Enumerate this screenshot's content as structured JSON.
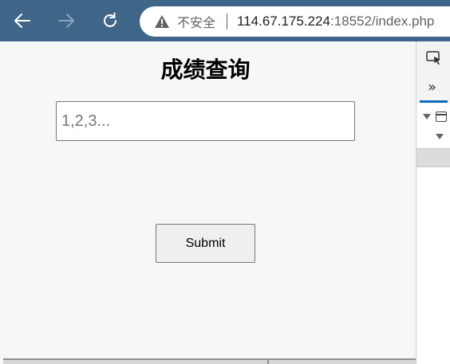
{
  "browser": {
    "back_icon": "arrow-left-icon",
    "forward_icon": "arrow-right-icon",
    "reload_icon": "reload-icon",
    "security_icon": "warning-triangle-icon",
    "security_text": "不安全",
    "url_host": "114.67.175.224",
    "url_rest": ":18552/index.php"
  },
  "page": {
    "title": "成绩查询",
    "query_input": {
      "value": "",
      "placeholder": "1,2,3..."
    },
    "submit_label": "Submit"
  },
  "devtools": {
    "inspect_icon": "inspect-element-icon",
    "more_tabs": "»",
    "tree_icon": "dom-node-icon"
  },
  "colors": {
    "browser_chrome": "#3f6689",
    "page_background": "#f7f7f7",
    "devtools_accent": "#0f6cbd"
  }
}
